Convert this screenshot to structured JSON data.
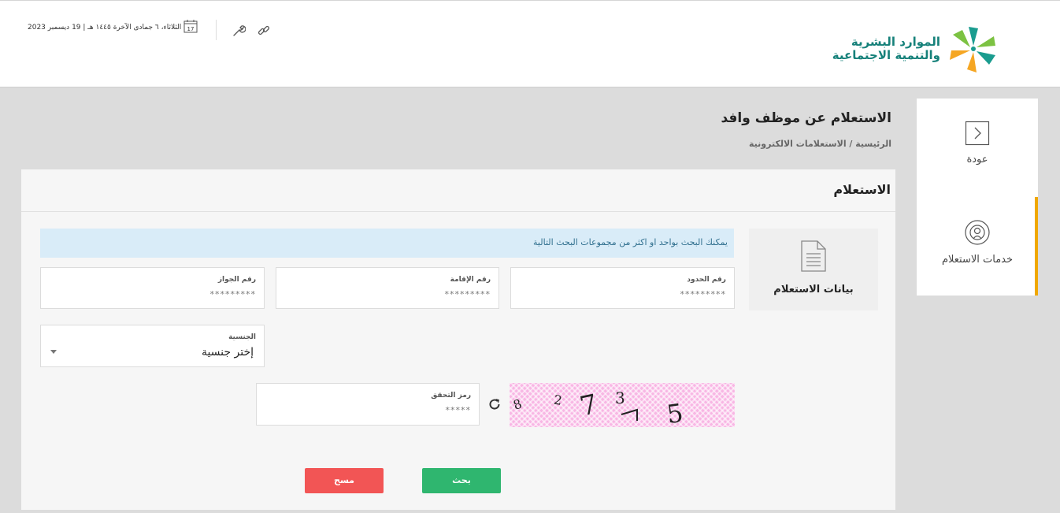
{
  "header": {
    "logo_line1": "الموارد البشرية",
    "logo_line2": "والتنمية الاجتماعية",
    "calendar_day": "17",
    "date_text": "الثلاثاء، ٦ جمادى الآخرة ١٤٤٥ هـ | 19 ديسمبر 2023",
    "icons": [
      "logo-mark",
      "calendar-icon",
      "wrench-icon",
      "link-icon"
    ]
  },
  "sidebar": {
    "items": [
      {
        "label": "عودة",
        "icon": "chevron-right-icon"
      },
      {
        "label": "خدمات الاستعلام",
        "icon": "broadcast-icon"
      }
    ]
  },
  "page": {
    "title": "الاستعلام عن موظف وافد",
    "breadcrumb": "الرئيسية / الاستعلامات الالكترونية"
  },
  "panel": {
    "title": "الاستعلام",
    "card_label": "بيانات الاستعلام",
    "info": "يمكنك البحث بواحد او اكثر من مجموعات البحث التالية",
    "fields": {
      "border_number": {
        "label": "رقم الحدود",
        "placeholder": "*********"
      },
      "iqama_number": {
        "label": "رقم الإقامة",
        "placeholder": "*********"
      },
      "passport_number": {
        "label": "رقم الجواز",
        "placeholder": "*********"
      },
      "nationality": {
        "label": "الجنسية",
        "selected": "إختر جنسية"
      },
      "captcha_code": {
        "label": "رمز التحقق",
        "placeholder": "*****"
      }
    },
    "buttons": {
      "search": "بحث",
      "clear": "مسح"
    }
  },
  "colors": {
    "brand_teal": "#16817a",
    "accent_orange": "#f0a800",
    "search_green": "#2fb66f",
    "clear_red": "#f25555",
    "info_bg": "#d9ecf8"
  }
}
